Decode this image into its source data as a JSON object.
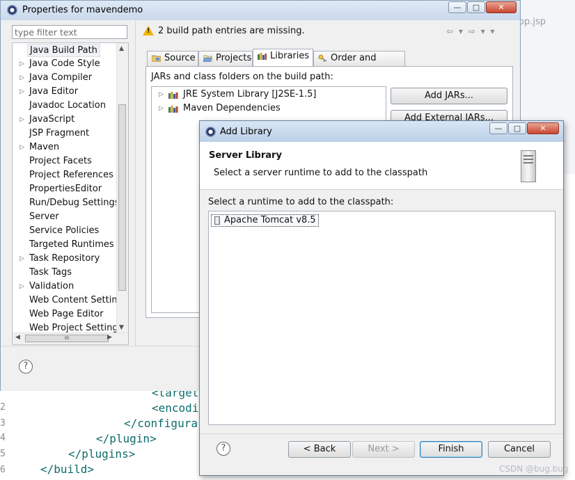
{
  "background_editor": {
    "tab_label": "op.jsp",
    "gutter_numbers": [
      "2",
      "3",
      "4",
      "5",
      "6"
    ],
    "code_lines": [
      "<target",
      "<encodi",
      "</configura",
      "</plugin>",
      "</plugins>",
      "</build>"
    ]
  },
  "properties_window": {
    "title": "Properties for mavendemo",
    "caption_buttons": [
      "—",
      "□",
      "✕"
    ],
    "filter_placeholder": "type filter text",
    "nav_items": [
      {
        "label": "Java Build Path",
        "expandable": false,
        "selected": true
      },
      {
        "label": "Java Code Style",
        "expandable": true
      },
      {
        "label": "Java Compiler",
        "expandable": true
      },
      {
        "label": "Java Editor",
        "expandable": true
      },
      {
        "label": "Javadoc Location",
        "expandable": false
      },
      {
        "label": "JavaScript",
        "expandable": true
      },
      {
        "label": "JSP Fragment",
        "expandable": false
      },
      {
        "label": "Maven",
        "expandable": true
      },
      {
        "label": "Project Facets",
        "expandable": false
      },
      {
        "label": "Project References",
        "expandable": false
      },
      {
        "label": "PropertiesEditor",
        "expandable": false
      },
      {
        "label": "Run/Debug Settings",
        "expandable": false
      },
      {
        "label": "Server",
        "expandable": false
      },
      {
        "label": "Service Policies",
        "expandable": false
      },
      {
        "label": "Targeted Runtimes",
        "expandable": false
      },
      {
        "label": "Task Repository",
        "expandable": true
      },
      {
        "label": "Task Tags",
        "expandable": false
      },
      {
        "label": "Validation",
        "expandable": true
      },
      {
        "label": "Web Content Settings",
        "expandable": false
      },
      {
        "label": "Web Page Editor",
        "expandable": false
      },
      {
        "label": "Web Project Settings",
        "expandable": false
      }
    ],
    "hscroll_thumb": "III",
    "warning": "2 build path entries are missing.",
    "tabs": [
      "Source",
      "Projects",
      "Libraries",
      "Order and Export"
    ],
    "active_tab": "Libraries",
    "panel_caption": "JARs and class folders on the build path:",
    "build_path_entries": [
      "JRE System Library [J2SE-1.5]",
      "Maven Dependencies"
    ],
    "side_buttons": [
      "Add JARs...",
      "Add External JARs..."
    ],
    "help_label": "?"
  },
  "add_library_dialog": {
    "title": "Add Library",
    "caption_buttons": [
      "—",
      "□",
      "✕"
    ],
    "heading": "Server Library",
    "subheading": "Select a server runtime to add to the classpath",
    "list_caption": "Select a runtime to add to the classpath:",
    "runtimes": [
      "Apache Tomcat v8.5"
    ],
    "help_label": "?",
    "buttons": {
      "back": "< Back",
      "next": "Next >",
      "finish": "Finish",
      "cancel": "Cancel"
    }
  },
  "watermark": "CSDN @bug.bug"
}
